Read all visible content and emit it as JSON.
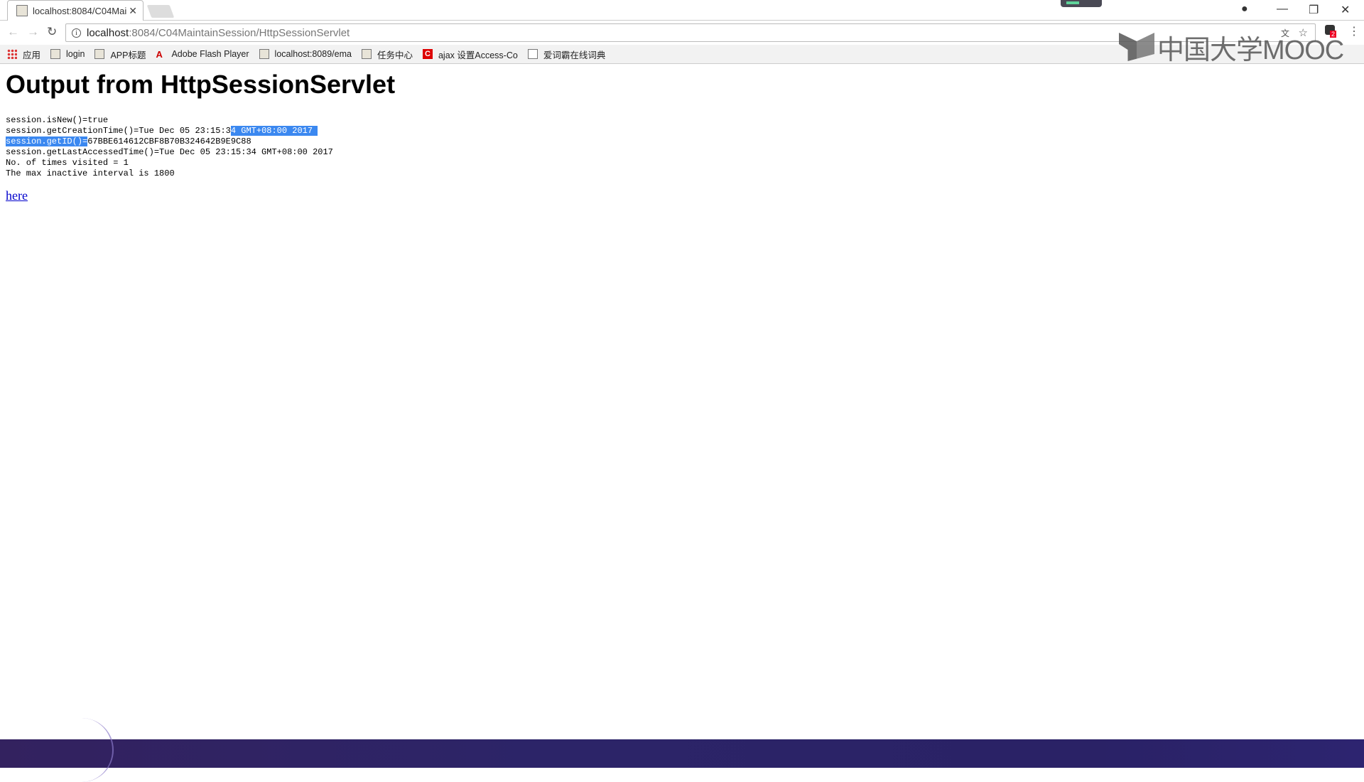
{
  "browser": {
    "tab_title": "localhost:8084/C04Mai",
    "url_host": "localhost",
    "url_rest": ":8084/C04MaintainSession/HttpSessionServlet",
    "bookmarks": [
      {
        "label": "应用",
        "icon": "apps-icon"
      },
      {
        "label": "login",
        "icon": "page-icon"
      },
      {
        "label": "APP标题",
        "icon": "page-icon"
      },
      {
        "label": "Adobe Flash Player",
        "icon": "adobe-icon"
      },
      {
        "label": "localhost:8089/ema",
        "icon": "page-icon"
      },
      {
        "label": "任务中心",
        "icon": "page-icon"
      },
      {
        "label": "ajax 设置Access-Co",
        "icon": "red-c-icon"
      },
      {
        "label": "爱词霸在线词典",
        "icon": "document-icon"
      }
    ],
    "extension_badge": "2"
  },
  "watermark": "中国大学MOOC",
  "page": {
    "heading": "Output from HttpSessionServlet",
    "lines": {
      "is_new": "session.isNew()=true",
      "creation_a": "session.getCreationTime()=Tue Dec 05 23:15:3",
      "creation_b": "4 GMT+08:00 2017 ",
      "id_a": "session.getID()=",
      "id_b": "67BBE614612CBF8B70B324642B9E9C88",
      "last_accessed": "session.getLastAccessedTime()=Tue Dec 05 23:15:34 GMT+08:00 2017",
      "visits": "No. of times visited = 1",
      "interval": "The max inactive interval is 1800"
    },
    "link": "here"
  },
  "colors": {
    "selection": "#3b88f0",
    "link": "#0000cc",
    "footer": "#2c2468"
  }
}
